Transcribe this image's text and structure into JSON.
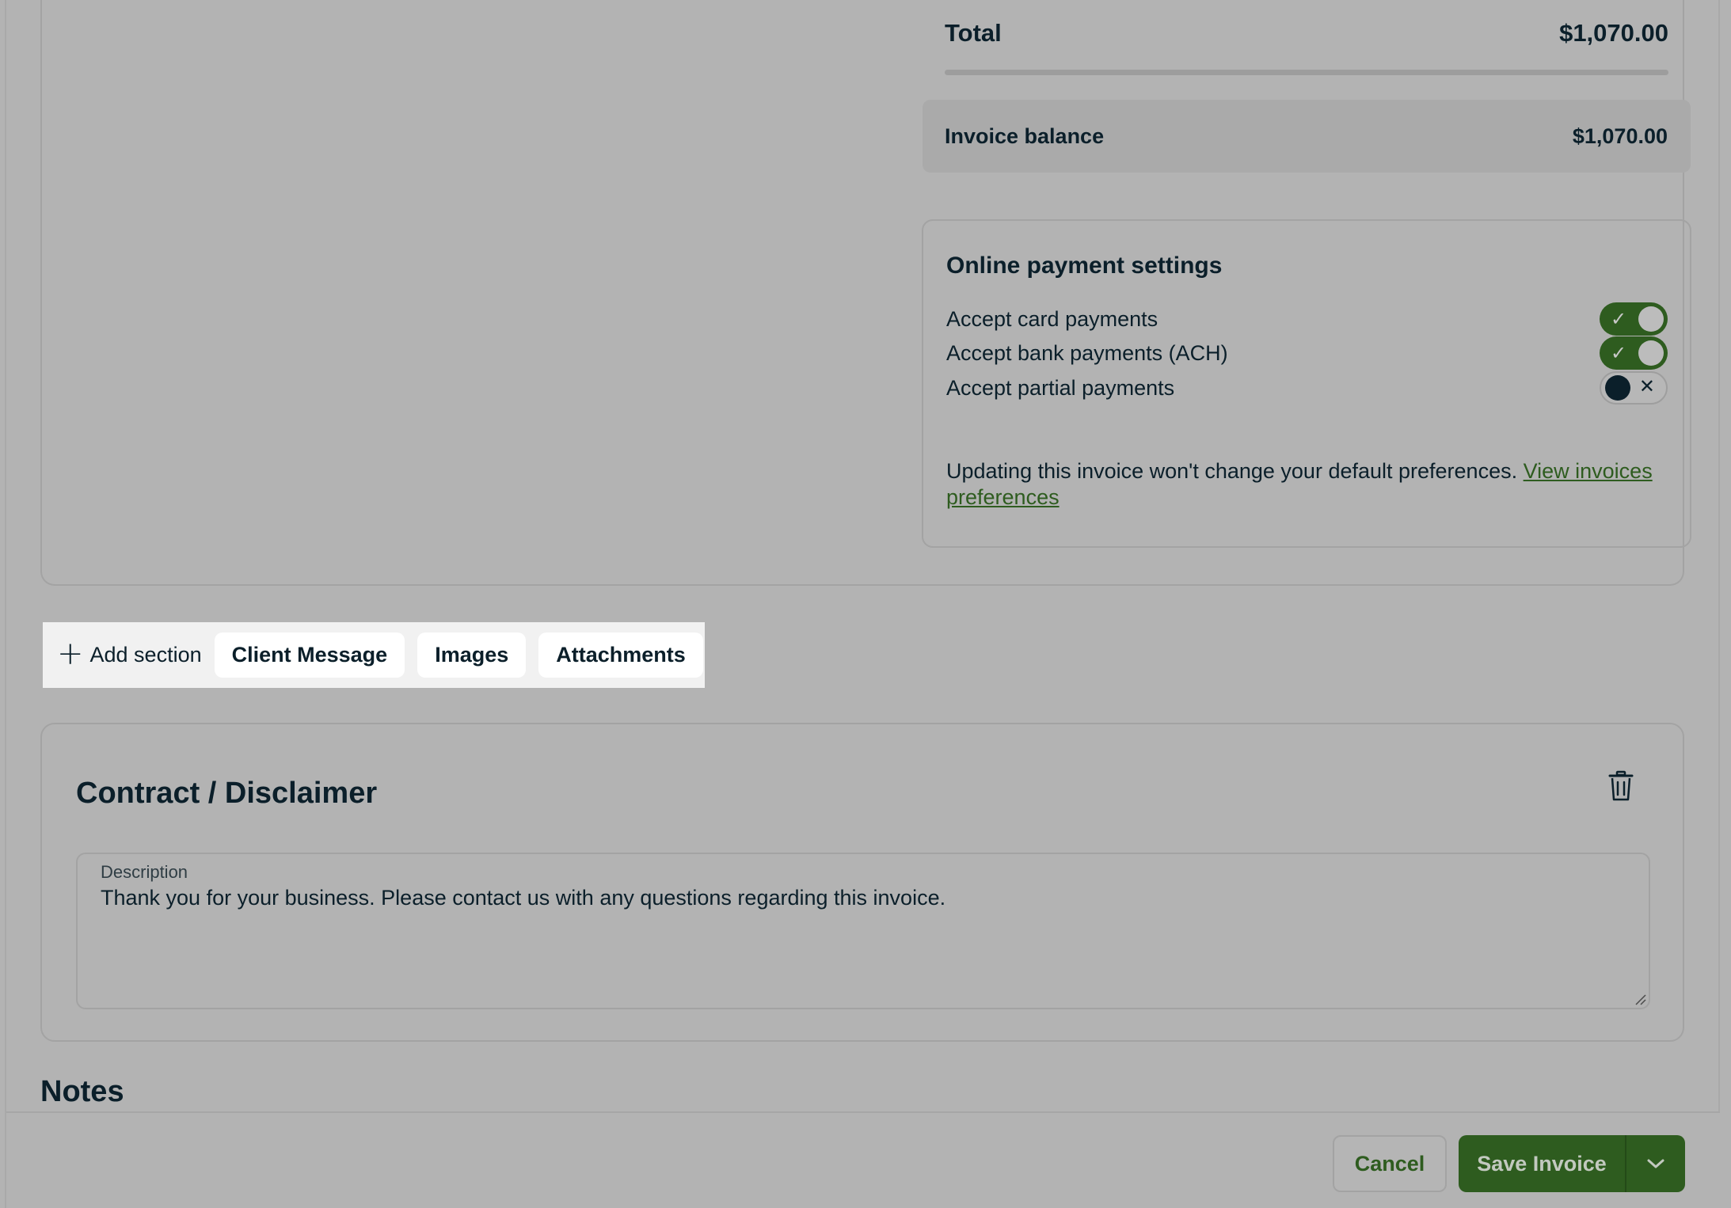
{
  "summary": {
    "total_label": "Total",
    "total_value": "$1,070.00",
    "balance_label": "Invoice balance",
    "balance_value": "$1,070.00"
  },
  "payment_settings": {
    "title": "Online payment settings",
    "options": [
      {
        "label": "Accept card payments",
        "enabled": true
      },
      {
        "label": "Accept bank payments (ACH)",
        "enabled": true
      },
      {
        "label": "Accept partial payments",
        "enabled": false
      }
    ],
    "note": "Updating this invoice won't change your default preferences.",
    "link_text": "View invoices preferences"
  },
  "add_section": {
    "label": "Add section",
    "chips": [
      "Client Message",
      "Images",
      "Attachments"
    ]
  },
  "contract": {
    "title": "Contract / Disclaimer",
    "description_label": "Description",
    "description_value": "Thank you for your business. Please contact us with any questions regarding this invoice."
  },
  "notes": {
    "title": "Notes"
  },
  "footer": {
    "cancel_label": "Cancel",
    "save_label": "Save Invoice"
  },
  "colors": {
    "accent_green": "#2e5c1f",
    "text_dark": "#0b1f2a"
  }
}
